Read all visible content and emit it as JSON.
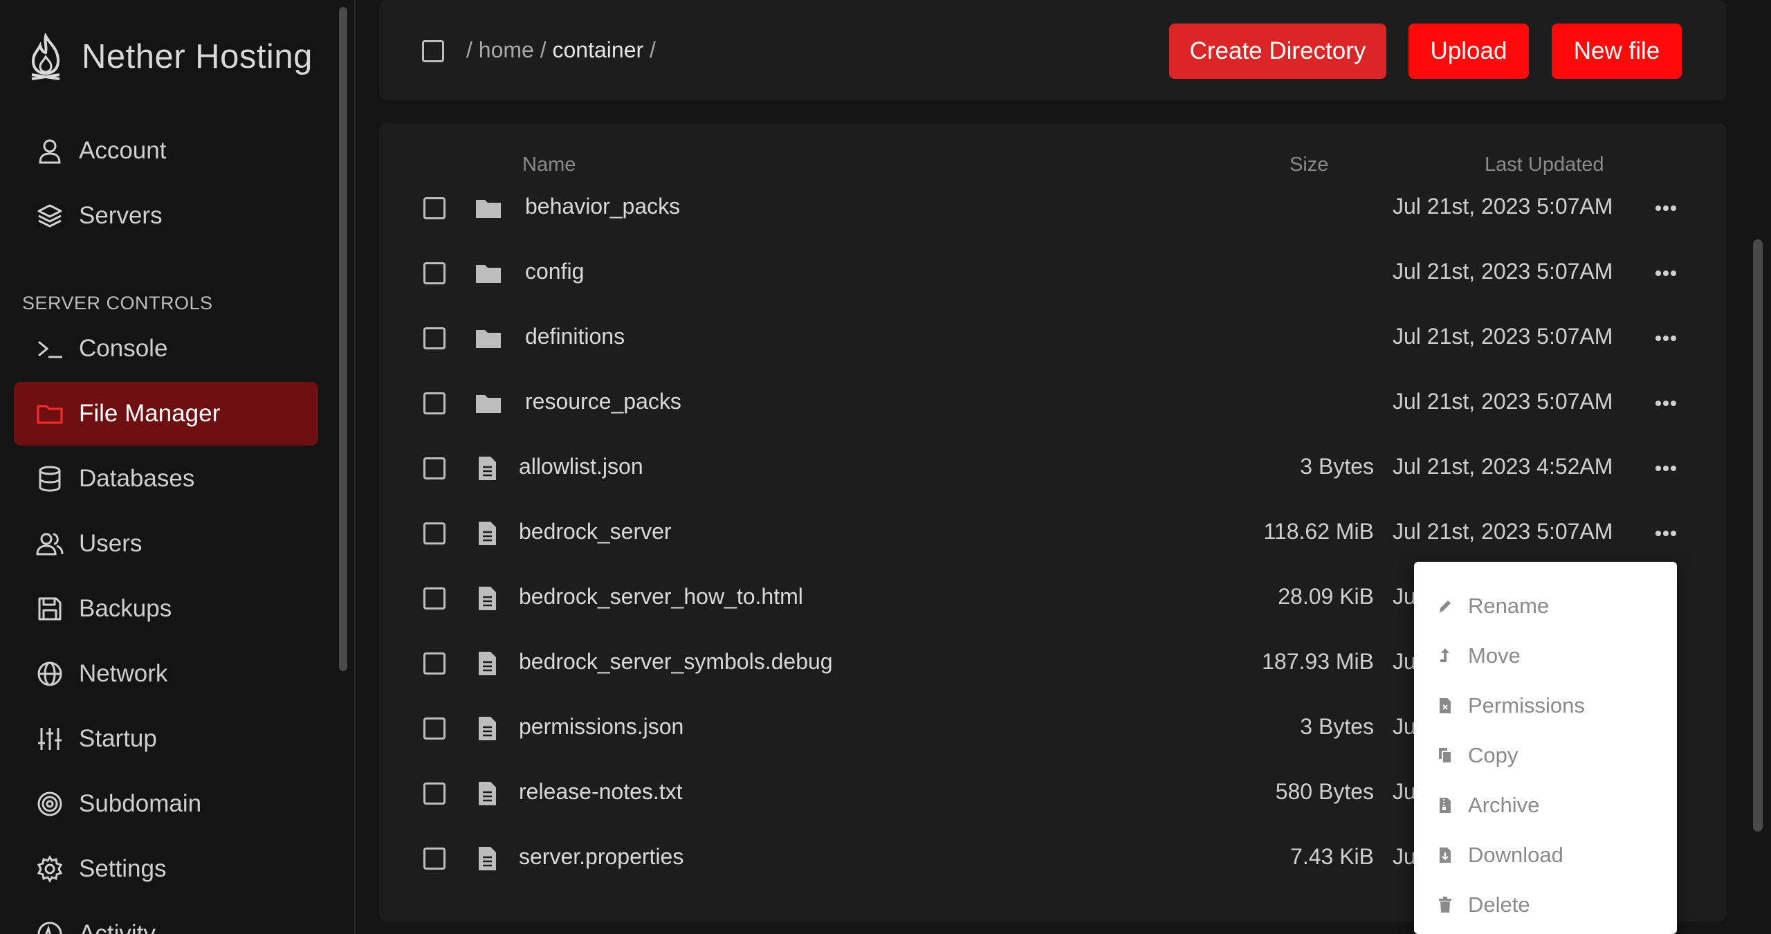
{
  "brand": {
    "name": "Nether Hosting"
  },
  "nav": {
    "top_items": [
      {
        "label": "Account",
        "icon": "user-icon"
      },
      {
        "label": "Servers",
        "icon": "layers-icon"
      }
    ],
    "section_label": "SERVER CONTROLS",
    "server_items": [
      {
        "label": "Console",
        "icon": "terminal-icon"
      },
      {
        "label": "File Manager",
        "icon": "folder-icon",
        "active": true
      },
      {
        "label": "Databases",
        "icon": "database-icon"
      },
      {
        "label": "Users",
        "icon": "users-icon"
      },
      {
        "label": "Backups",
        "icon": "save-icon"
      },
      {
        "label": "Network",
        "icon": "globe-icon"
      },
      {
        "label": "Startup",
        "icon": "sliders-icon"
      },
      {
        "label": "Subdomain",
        "icon": "target-icon"
      },
      {
        "label": "Settings",
        "icon": "gear-icon"
      },
      {
        "label": "Activity",
        "icon": "activity-icon"
      }
    ]
  },
  "breadcrumb": {
    "sep": "/",
    "home": "home",
    "current": "container"
  },
  "toolbar": {
    "create_directory": "Create Directory",
    "upload": "Upload",
    "new_file": "New file"
  },
  "columns": {
    "name": "Name",
    "size": "Size",
    "updated": "Last Updated"
  },
  "files": [
    {
      "name": "behavior_packs",
      "type": "folder",
      "size": "",
      "updated": "Jul 21st, 2023 5:07AM"
    },
    {
      "name": "config",
      "type": "folder",
      "size": "",
      "updated": "Jul 21st, 2023 5:07AM"
    },
    {
      "name": "definitions",
      "type": "folder",
      "size": "",
      "updated": "Jul 21st, 2023 5:07AM"
    },
    {
      "name": "resource_packs",
      "type": "folder",
      "size": "",
      "updated": "Jul 21st, 2023 5:07AM"
    },
    {
      "name": "allowlist.json",
      "type": "file",
      "size": "3 Bytes",
      "updated": "Jul 21st, 2023 4:52AM"
    },
    {
      "name": "bedrock_server",
      "type": "file",
      "size": "118.62 MiB",
      "updated": "Jul 21st, 2023 5:07AM"
    },
    {
      "name": "bedrock_server_how_to.html",
      "type": "file",
      "size": "28.09 KiB",
      "updated": "Ju"
    },
    {
      "name": "bedrock_server_symbols.debug",
      "type": "file",
      "size": "187.93 MiB",
      "updated": "Ju"
    },
    {
      "name": "permissions.json",
      "type": "file",
      "size": "3 Bytes",
      "updated": "Ju"
    },
    {
      "name": "release-notes.txt",
      "type": "file",
      "size": "580 Bytes",
      "updated": "Ju"
    },
    {
      "name": "server.properties",
      "type": "file",
      "size": "7.43 KiB",
      "updated": "Ju"
    }
  ],
  "context_menu": [
    {
      "label": "Rename",
      "icon": "pencil-icon"
    },
    {
      "label": "Move",
      "icon": "move-icon"
    },
    {
      "label": "Permissions",
      "icon": "permissions-file-icon"
    },
    {
      "label": "Copy",
      "icon": "copy-icon"
    },
    {
      "label": "Archive",
      "icon": "archive-icon"
    },
    {
      "label": "Download",
      "icon": "download-icon"
    },
    {
      "label": "Delete",
      "icon": "trash-icon"
    }
  ],
  "colors": {
    "accent": "#ff0a0a",
    "active_nav": "#6e0f11",
    "background": "#151515",
    "card": "#1d1d1d"
  }
}
